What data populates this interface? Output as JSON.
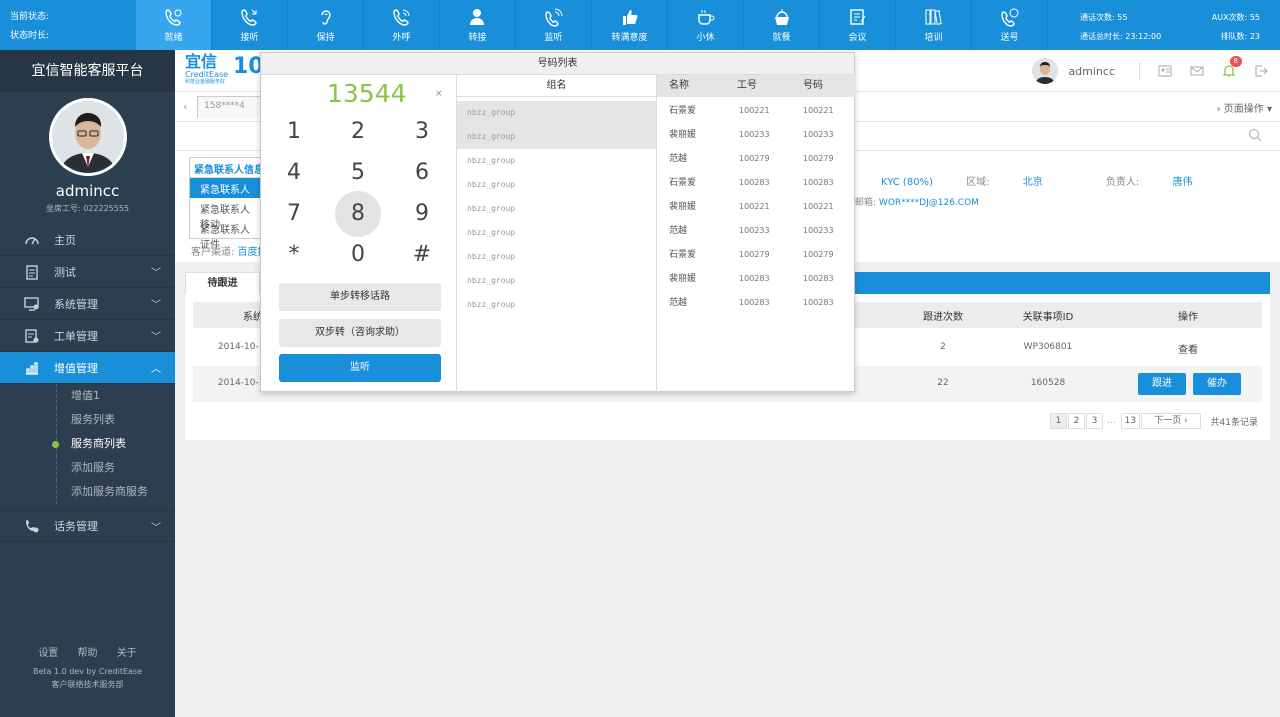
{
  "status_left": {
    "line1": "当前状态:",
    "line2": "状态时长:"
  },
  "toolbar": [
    {
      "label": "就绪",
      "icon": "phone-ready-icon"
    },
    {
      "label": "接听",
      "icon": "phone-answer-icon"
    },
    {
      "label": "保持",
      "icon": "ear-icon"
    },
    {
      "label": "外呼",
      "icon": "phone-outgoing-icon"
    },
    {
      "label": "转接",
      "icon": "transfer-user-icon"
    },
    {
      "label": "监听",
      "icon": "monitor-phone-icon"
    },
    {
      "label": "转满意度",
      "icon": "thumbs-up-icon"
    },
    {
      "label": "小休",
      "icon": "coffee-icon"
    },
    {
      "label": "就餐",
      "icon": "meal-icon"
    },
    {
      "label": "会议",
      "icon": "meeting-icon"
    },
    {
      "label": "培训",
      "icon": "training-icon"
    },
    {
      "label": "送号",
      "icon": "send-number-icon"
    }
  ],
  "status_right": {
    "calls_label": "通话次数:",
    "calls_value": "55",
    "aux_label": "AUX次数:",
    "aux_value": "55",
    "total_label": "通话总时长:",
    "total_value": "23:12:00",
    "queue_label": "排队数:",
    "queue_value": "23"
  },
  "sidebar": {
    "platform_title": "宜信智能客服平台",
    "username": "admincc",
    "seat_id": "坐席工号: 022225555",
    "menu": [
      {
        "label": "主页",
        "icon": "dashboard-icon",
        "chevron": ""
      },
      {
        "label": "测试",
        "icon": "clipboard-icon",
        "chevron": "﹀"
      },
      {
        "label": "系统管理",
        "icon": "monitor-settings-icon",
        "chevron": "﹀"
      },
      {
        "label": "工单管理",
        "icon": "workorder-icon",
        "chevron": "﹀"
      },
      {
        "label": "增值管理",
        "icon": "chart-icon",
        "chevron": "︿"
      }
    ],
    "submenu": [
      "增值1",
      "服务列表",
      "服务商列表",
      "添加服务",
      "添加服务商服务"
    ],
    "menu_bottom": {
      "label": "话务管理",
      "icon": "phone-settings-icon",
      "chevron": "﹀"
    },
    "footer_links": [
      "设置",
      "帮助",
      "关于"
    ],
    "footer_line1": "Beta 1.0 dev by CreditEase",
    "footer_line2": "客户联络技术服务部"
  },
  "header": {
    "logo_cn": "宜信",
    "logo_en": "CreditEase",
    "logo_num": "10",
    "logo_sub": "科技业金融服务好",
    "username": "admincc",
    "badge": "8"
  },
  "tabs": {
    "tab1": "158****4",
    "page_ops": "页面操作"
  },
  "emergency": {
    "title": "紧急联系人信息",
    "items": [
      "紧急联系人姓名",
      "紧急联系人移动",
      "紧急联系人证件"
    ]
  },
  "customer": {
    "channel_label": "客户渠道:",
    "channel_value": "百度推",
    "kyc": "KYC (80%)",
    "region_label": "区域:",
    "region_value": "北京",
    "owner_label": "负责人:",
    "owner_value": "唐伟",
    "email_label": "邮箱:",
    "email_value": "WOR****DJ@126.COM"
  },
  "panel": {
    "tab_active": "待跟进",
    "columns": {
      "system": "系统",
      "follow_count": "跟进次数",
      "event_id": "关联事项ID",
      "actions": "操作"
    },
    "rows": [
      {
        "date": "2014-10-16",
        "count": "2",
        "event_id": "WP306801",
        "action": "查看"
      },
      {
        "date": "2014-10-16",
        "count": "22",
        "event_id": "160528",
        "btn1": "跟进",
        "btn2": "催办"
      }
    ],
    "pager": {
      "pages": [
        "1",
        "2",
        "3",
        "...",
        "13"
      ],
      "next": "下一页 ›",
      "total": "共41条记录"
    }
  },
  "dialer": {
    "title": "号码列表",
    "number": "13544",
    "clear": "×",
    "keys": [
      "1",
      "2",
      "3",
      "4",
      "5",
      "6",
      "7",
      "8",
      "9",
      "*",
      "0",
      "#"
    ],
    "btn_single": "单步转移话路",
    "btn_double": "双步转（咨询求助）",
    "btn_monitor": "监听",
    "group_header": "组名",
    "groups": [
      "nbzz_group",
      "nbzz_group",
      "nbzz_group",
      "nbzz_group",
      "nbzz_group",
      "nbzz_group",
      "nbzz_group",
      "nbzz_group",
      "nbzz_group"
    ],
    "member_headers": {
      "name": "名称",
      "id": "工号",
      "number": "号码"
    },
    "members": [
      {
        "name": "石景爱",
        "id": "100221",
        "number": "100221"
      },
      {
        "name": "裴丽媛",
        "id": "100233",
        "number": "100233"
      },
      {
        "name": "范越",
        "id": "100279",
        "number": "100279"
      },
      {
        "name": "石景爱",
        "id": "100283",
        "number": "100283"
      },
      {
        "name": "裴丽媛",
        "id": "100221",
        "number": "100221"
      },
      {
        "name": "范越",
        "id": "100233",
        "number": "100233"
      },
      {
        "name": "石景爱",
        "id": "100279",
        "number": "100279"
      },
      {
        "name": "裴丽媛",
        "id": "100283",
        "number": "100283"
      },
      {
        "name": "范越",
        "id": "100283",
        "number": "100283"
      }
    ]
  },
  "colors": {
    "primary": "#1a8fd9",
    "sidebar": "#2c3e4f",
    "accent_green": "#8bc34a"
  }
}
